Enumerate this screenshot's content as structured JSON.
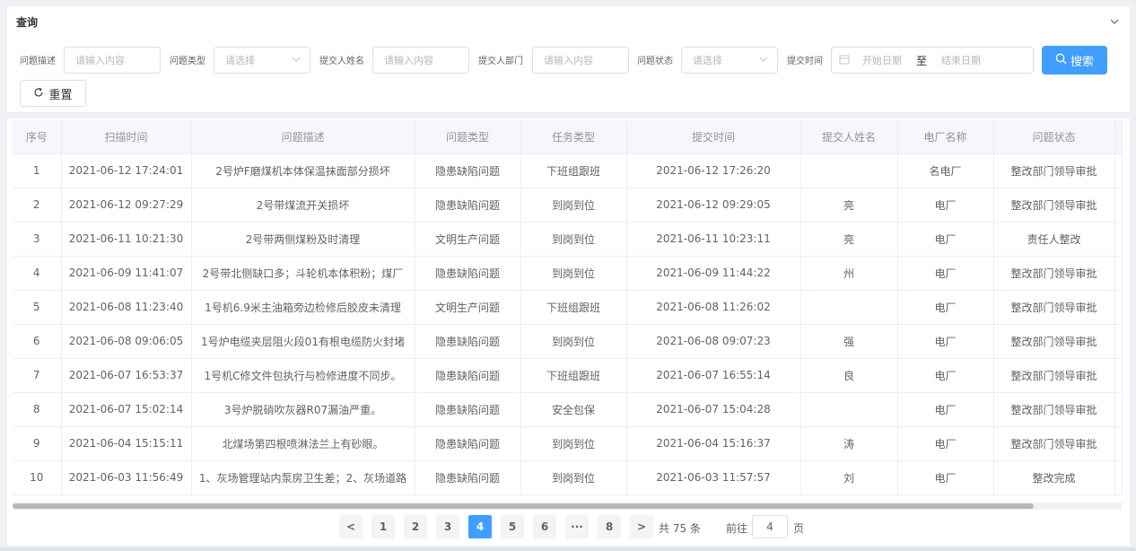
{
  "query": {
    "title": "查询",
    "filters": [
      {
        "label": "问题描述",
        "placeholder": "请输入内容"
      },
      {
        "label": "问题类型",
        "placeholder": "请选择"
      },
      {
        "label": "提交人姓名",
        "placeholder": "请输入内容"
      },
      {
        "label": "提交人部门",
        "placeholder": "请输入内容"
      },
      {
        "label": "问题状态",
        "placeholder": "请选择"
      },
      {
        "label": "提交时间",
        "start_placeholder": "开始日期",
        "separator": "至",
        "end_placeholder": "结束日期"
      }
    ],
    "search_label": "搜索",
    "reset_label": "重置"
  },
  "table": {
    "columns": [
      "序号",
      "扫描时间",
      "问题描述",
      "问题类型",
      "任务类型",
      "提交时间",
      "提交人姓名",
      "电厂名称",
      "问题状态"
    ],
    "rows": [
      {
        "no": "1",
        "scan_time": "2021-06-12 17:24:01",
        "desc": "2号炉F磨煤机本体保温抹面部分损坏",
        "issue_type": "隐患缺陷问题",
        "task_type": "下班组跟班",
        "submit_time": "2021-06-12 17:26:20",
        "submitter": "",
        "plant": "名电厂",
        "status": "整改部门领导审批"
      },
      {
        "no": "2",
        "scan_time": "2021-06-12 09:27:29",
        "desc": "2号带煤流开关损坏",
        "issue_type": "隐患缺陷问题",
        "task_type": "到岗到位",
        "submit_time": "2021-06-12 09:29:05",
        "submitter": "亮",
        "plant": "电厂",
        "status": "整改部门领导审批"
      },
      {
        "no": "3",
        "scan_time": "2021-06-11 10:21:30",
        "desc": "2号带两侧煤粉及时清理",
        "issue_type": "文明生产问题",
        "task_type": "到岗到位",
        "submit_time": "2021-06-11 10:23:11",
        "submitter": "亮",
        "plant": "电厂",
        "status": "责任人整改"
      },
      {
        "no": "4",
        "scan_time": "2021-06-09 11:41:07",
        "desc": "2号带北侧缺口多；斗轮机本体积粉；煤厂",
        "issue_type": "隐患缺陷问题",
        "task_type": "到岗到位",
        "submit_time": "2021-06-09 11:44:22",
        "submitter": "州",
        "plant": "电厂",
        "status": "整改部门领导审批"
      },
      {
        "no": "5",
        "scan_time": "2021-06-08 11:23:40",
        "desc": "1号机6.9米主油箱旁边检修后胶皮未清理",
        "issue_type": "文明生产问题",
        "task_type": "下班组跟班",
        "submit_time": "2021-06-08 11:26:02",
        "submitter": "",
        "plant": "电厂",
        "status": "整改部门领导审批"
      },
      {
        "no": "6",
        "scan_time": "2021-06-08 09:06:05",
        "desc": "1号炉电缆夹层阻火段01有根电缆防火封堵",
        "issue_type": "隐患缺陷问题",
        "task_type": "到岗到位",
        "submit_time": "2021-06-08 09:07:23",
        "submitter": "强",
        "plant": "电厂",
        "status": "整改部门领导审批"
      },
      {
        "no": "7",
        "scan_time": "2021-06-07 16:53:37",
        "desc": "1号机C修文件包执行与检修进度不同步。",
        "issue_type": "隐患缺陷问题",
        "task_type": "下班组跟班",
        "submit_time": "2021-06-07 16:55:14",
        "submitter": "良",
        "plant": "电厂",
        "status": "整改部门领导审批"
      },
      {
        "no": "8",
        "scan_time": "2021-06-07 15:02:14",
        "desc": "3号炉脱硝吹灰器R07漏油严重。",
        "issue_type": "隐患缺陷问题",
        "task_type": "安全包保",
        "submit_time": "2021-06-07 15:04:28",
        "submitter": "",
        "plant": "电厂",
        "status": "整改部门领导审批"
      },
      {
        "no": "9",
        "scan_time": "2021-06-04 15:15:11",
        "desc": "北煤场第四根喷淋法兰上有砂眼。",
        "issue_type": "隐患缺陷问题",
        "task_type": "到岗到位",
        "submit_time": "2021-06-04 15:16:37",
        "submitter": "涛",
        "plant": "电厂",
        "status": "整改部门领导审批"
      },
      {
        "no": "10",
        "scan_time": "2021-06-03 11:56:49",
        "desc": "1、灰场管理站内泵房卫生差；2、灰场道路",
        "issue_type": "隐患缺陷问题",
        "task_type": "到岗到位",
        "submit_time": "2021-06-03 11:57:57",
        "submitter": "刘",
        "plant": "电厂",
        "status": "整改完成"
      }
    ]
  },
  "pagination": {
    "prev": "<",
    "pages": [
      "1",
      "2",
      "3",
      "4",
      "5",
      "6",
      "···",
      "8"
    ],
    "active_page": "4",
    "next": ">",
    "total_text": "共 75 条",
    "goto_prefix": "前往",
    "goto_value": "4",
    "goto_suffix": "页"
  },
  "colors": {
    "accent": "#409eff",
    "header_bg": "#f5f7fa",
    "border": "#ebeef5"
  }
}
